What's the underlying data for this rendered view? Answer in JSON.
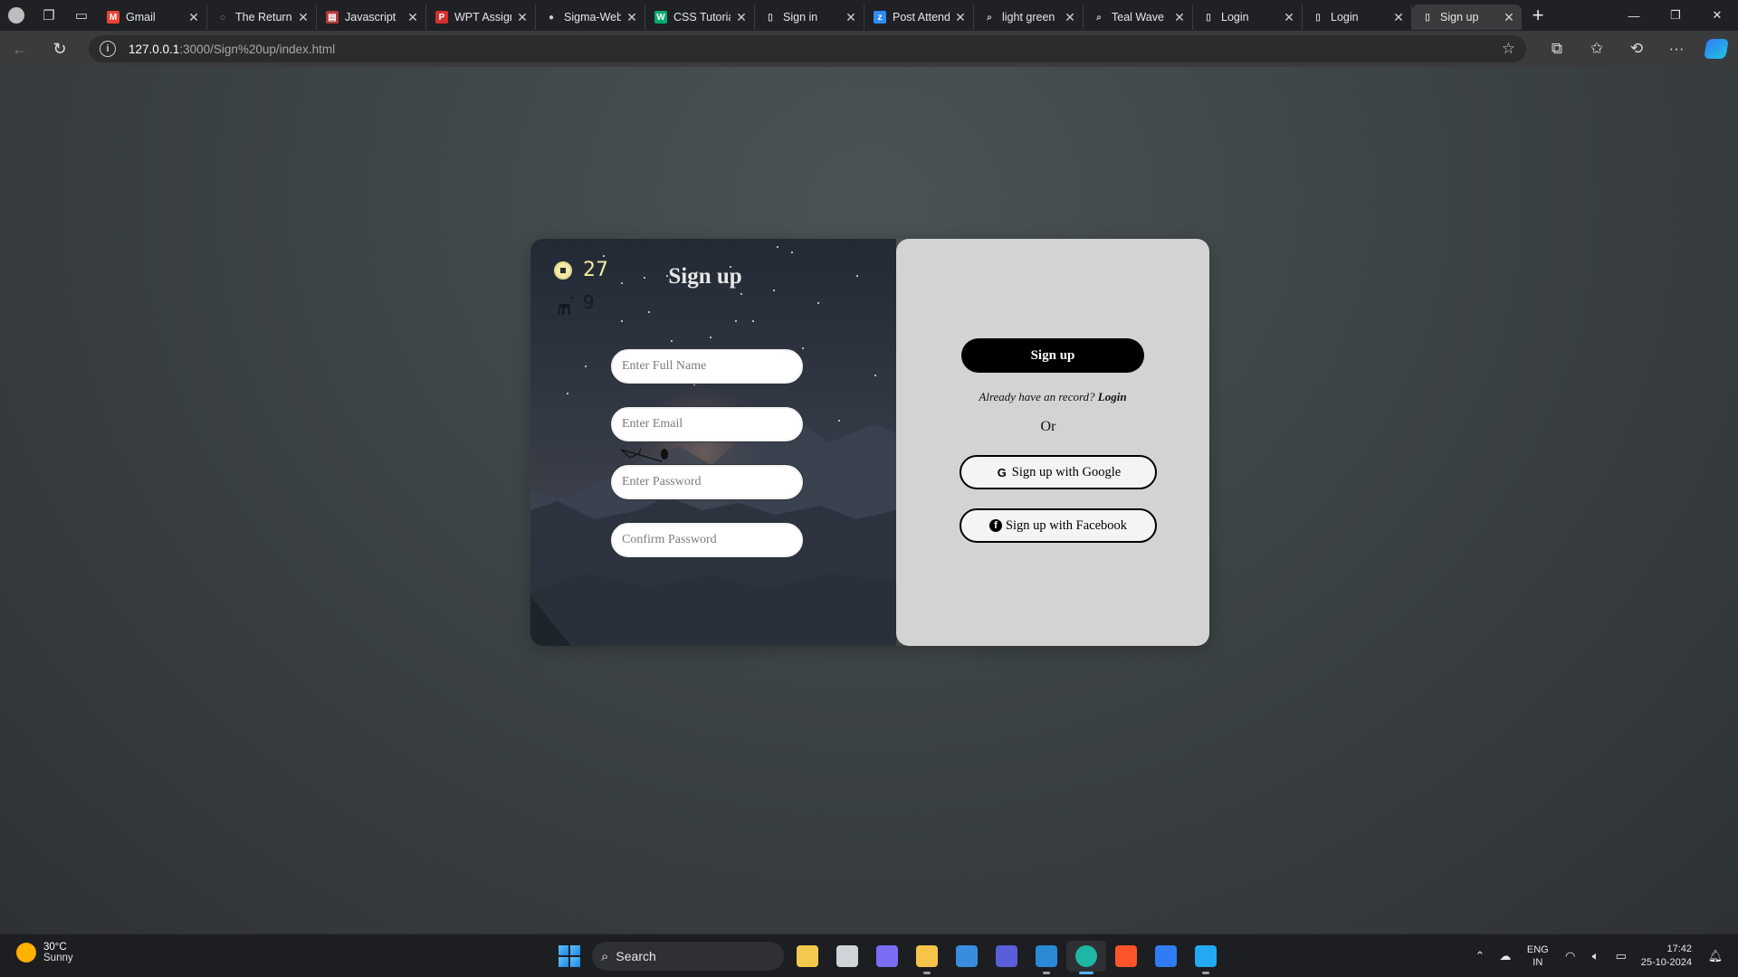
{
  "browser": {
    "tabs": [
      {
        "title": "Gmail",
        "favicon": "gmail-icon",
        "fav_color": "#ea4335",
        "fav_char": "M"
      },
      {
        "title": "The Return",
        "favicon": "openai-icon",
        "fav_color": "#303030",
        "fav_char": "◌"
      },
      {
        "title": "Javascript",
        "favicon": "javascript-icon",
        "fav_color": "#b23a3a",
        "fav_char": "▤"
      },
      {
        "title": "WPT Assign",
        "favicon": "pdf-icon",
        "fav_color": "#d32f2f",
        "fav_char": "P"
      },
      {
        "title": "Sigma-Web",
        "favicon": "github-icon",
        "fav_color": "#202124",
        "fav_char": "●"
      },
      {
        "title": "CSS Tutoria",
        "favicon": "w3schools-icon",
        "fav_color": "#04aa6d",
        "fav_char": "W"
      },
      {
        "title": "Sign in",
        "favicon": "page-icon",
        "fav_color": "#202124",
        "fav_char": "▯"
      },
      {
        "title": "Post Attend",
        "favicon": "zoom-icon",
        "fav_color": "#2d8cff",
        "fav_char": "z"
      },
      {
        "title": "light green",
        "favicon": "search-icon",
        "fav_color": "#202124",
        "fav_char": "⌕"
      },
      {
        "title": "Teal Wave",
        "favicon": "search-icon",
        "fav_color": "#202124",
        "fav_char": "⌕"
      },
      {
        "title": "Login",
        "favicon": "page-icon",
        "fav_color": "#202124",
        "fav_char": "▯"
      },
      {
        "title": "Login",
        "favicon": "page-icon",
        "fav_color": "#202124",
        "fav_char": "▯"
      },
      {
        "title": "Sign up",
        "favicon": "page-icon",
        "fav_color": "#202124",
        "fav_char": "▯",
        "active": true
      }
    ],
    "url_host": "127.0.0.1",
    "url_path": ":3000/Sign%20up/index.html"
  },
  "page": {
    "hud": {
      "coins": "27",
      "deer": "9"
    },
    "title": "Sign up",
    "fields": {
      "full_name_placeholder": "Enter Full Name",
      "email_placeholder": "Enter Email",
      "password_placeholder": "Enter Password",
      "confirm_placeholder": "Confirm Password"
    },
    "signup_button": "Sign up",
    "already_text": "Already have an record?",
    "login_link": "Login",
    "or_text": "Or",
    "google_button": "Sign up with Google",
    "facebook_button": "Sign up with Facebook"
  },
  "taskbar": {
    "weather_temp": "30°C",
    "weather_desc": "Sunny",
    "search_label": "Search",
    "lang_line1": "ENG",
    "lang_line2": "IN",
    "time": "17:42",
    "date": "25-10-2024",
    "apps": [
      {
        "name": "widgets-app",
        "color": "#f2c94c"
      },
      {
        "name": "task-view-app",
        "color": "#cfd4da"
      },
      {
        "name": "copilot-app",
        "color": "#7b6cf6"
      },
      {
        "name": "file-explorer-app",
        "color": "#f7c44a"
      },
      {
        "name": "store-app",
        "color": "#3a8dde"
      },
      {
        "name": "visual-studio-app",
        "color": "#5a5fd9"
      },
      {
        "name": "bing-app",
        "color": "#2a8ad6"
      },
      {
        "name": "edge-app",
        "color": "#1fb6a6",
        "active": true
      },
      {
        "name": "brave-app",
        "color": "#fb542b"
      },
      {
        "name": "todo-app",
        "color": "#2f7cf6"
      },
      {
        "name": "vscode-app",
        "color": "#23a9f2"
      }
    ]
  },
  "colors": {
    "accent": "#000000",
    "coin": "#f1ec9e",
    "panel_right": "#d3d3d3"
  }
}
